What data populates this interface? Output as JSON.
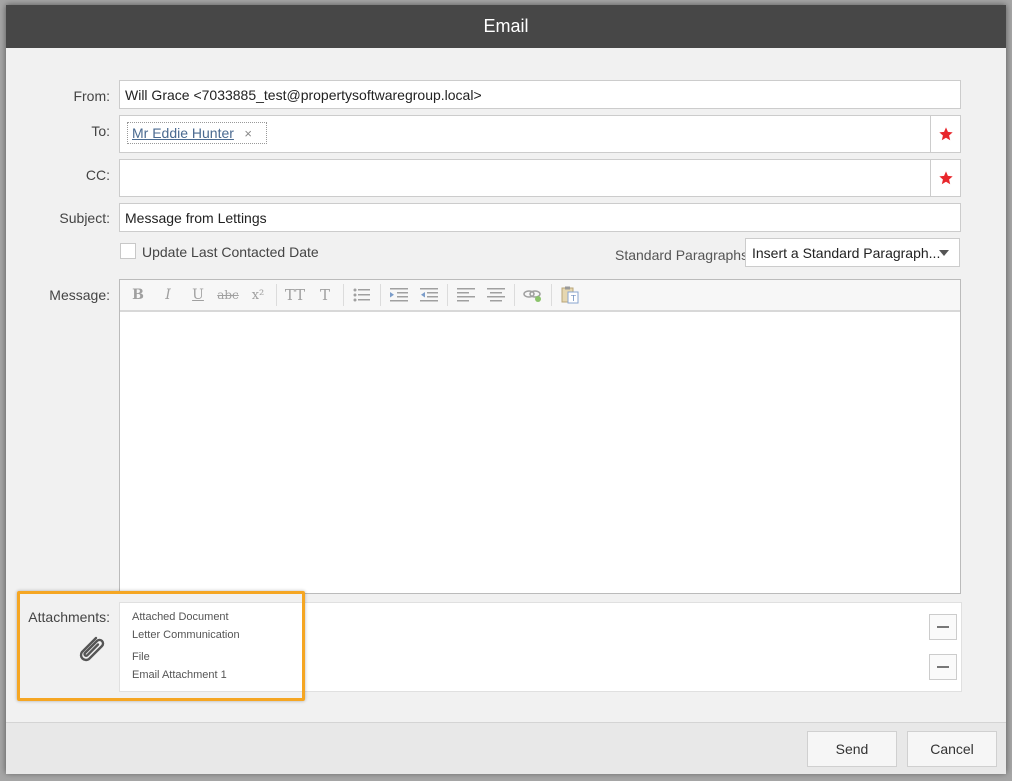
{
  "dialog": {
    "title": "Email"
  },
  "form": {
    "from_label": "From:",
    "from_value": "Will Grace <7033885_test@propertysoftwaregroup.local>",
    "to_label": "To:",
    "to_recipient": "Mr Eddie Hunter",
    "to_remove_icon": "×",
    "cc_label": "CC:",
    "cc_value": "",
    "subject_label": "Subject:",
    "subject_value": "Message from Lettings",
    "update_contacted_label": "Update Last Contacted Date",
    "update_contacted_checked": false,
    "standard_paragraphs_label": "Standard Paragraphs",
    "standard_paragraphs_value": "Insert a Standard Paragraph...",
    "message_label": "Message:",
    "attachments_label": "Attachments:"
  },
  "toolbar": {
    "bold": "B",
    "italic": "I",
    "underline": "U",
    "strike": "abc",
    "superscript": "x²",
    "font_size": "TT",
    "clear_format": "T"
  },
  "attachments": [
    {
      "type": "Attached Document",
      "name": "Letter Communication"
    },
    {
      "type": "File",
      "name": "Email Attachment 1"
    }
  ],
  "footer": {
    "send_label": "Send",
    "cancel_label": "Cancel"
  },
  "colors": {
    "accent_highlight": "#f5a623",
    "star": "#e8262b",
    "titlebar": "#474747"
  }
}
